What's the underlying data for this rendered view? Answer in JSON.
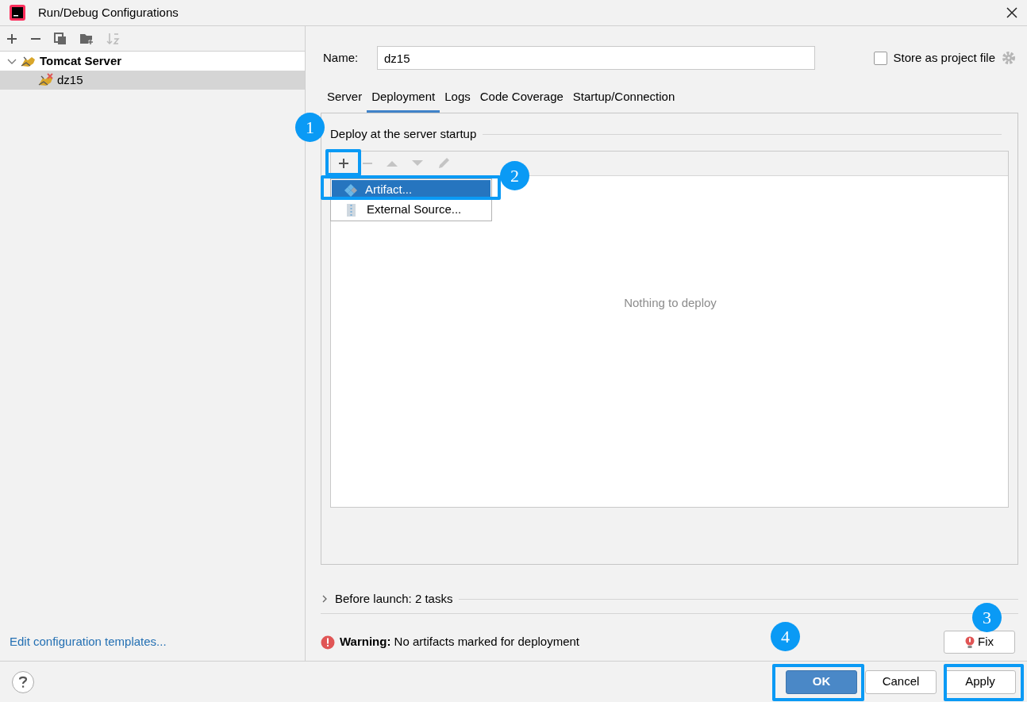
{
  "window": {
    "title": "Run/Debug Configurations"
  },
  "tree": [
    {
      "label": "Tomcat Server",
      "expanded": true,
      "selected": false,
      "children": [
        {
          "label": "dz15",
          "selected": true,
          "error": true
        }
      ]
    }
  ],
  "templates_link": "Edit configuration templates...",
  "name_field": {
    "label": "Name:",
    "value": "dz15"
  },
  "store_checkbox": {
    "label": "Store as project file",
    "checked": false
  },
  "tabs": [
    {
      "label": "Server",
      "selected": false
    },
    {
      "label": "Deployment",
      "selected": true
    },
    {
      "label": "Logs",
      "selected": false
    },
    {
      "label": "Code Coverage",
      "selected": false
    },
    {
      "label": "Startup/Connection",
      "selected": false
    }
  ],
  "deploy_group": {
    "title": "Deploy at the server startup",
    "empty_text": "Nothing to deploy"
  },
  "add_menu": [
    {
      "label": "Artifact...",
      "kind": "artifact",
      "selected": true
    },
    {
      "label": "External Source...",
      "kind": "external",
      "selected": false
    }
  ],
  "before_launch": {
    "label": "Before launch: 2 tasks",
    "expanded": false
  },
  "warning": {
    "label": "Warning:",
    "message": "No artifacts marked for deployment"
  },
  "fix_button": "Fix",
  "buttons": [
    {
      "label": "OK",
      "default": true
    },
    {
      "label": "Cancel",
      "default": false
    },
    {
      "label": "Apply",
      "default": false
    }
  ],
  "callouts": [
    "1",
    "2",
    "3",
    "4"
  ]
}
